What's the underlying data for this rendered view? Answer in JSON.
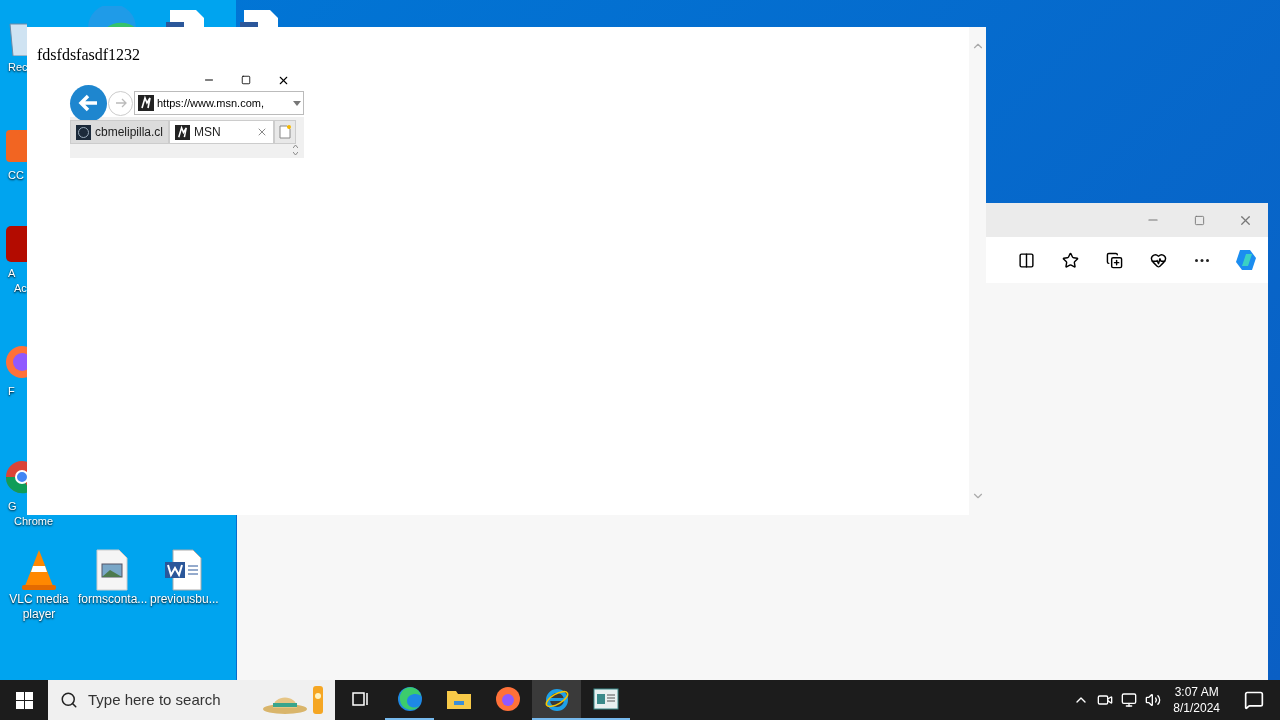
{
  "desktop": {
    "icons": [
      {
        "kind": "recycle",
        "lines": [
          "Rec"
        ]
      },
      {
        "kind": "shortcut",
        "lines": [
          "CC"
        ]
      },
      {
        "kind": "acrobat",
        "lines": [
          "A",
          "Ac"
        ]
      },
      {
        "kind": "firefox",
        "lines": [
          "F"
        ]
      },
      {
        "kind": "chrome",
        "lines": [
          "G",
          "Chrome"
        ]
      },
      {
        "kind": "vlc",
        "lines": [
          "VLC media",
          "player"
        ]
      },
      {
        "kind": "image",
        "lines": [
          "formsconta..."
        ]
      },
      {
        "kind": "word",
        "lines": [
          "previousbu..."
        ]
      }
    ]
  },
  "popup": {
    "heading": "fdsfdsfasdf1232",
    "browser": {
      "address": "https://www.msn.com,",
      "tabs": [
        {
          "label": "cbmelipilla.cl",
          "selected": false
        },
        {
          "label": "MSN",
          "selected": true
        }
      ]
    }
  },
  "taskbar": {
    "search_placeholder": "Type here to search",
    "apps": [
      {
        "kind": "taskview",
        "running": false,
        "selected": false
      },
      {
        "kind": "edge",
        "running": true,
        "selected": false
      },
      {
        "kind": "explorer",
        "running": false,
        "selected": false
      },
      {
        "kind": "firefox",
        "running": false,
        "selected": false
      },
      {
        "kind": "ie",
        "running": true,
        "selected": true
      },
      {
        "kind": "app",
        "running": true,
        "selected": false
      }
    ],
    "time": "3:07 AM",
    "date": "8/1/2024"
  }
}
